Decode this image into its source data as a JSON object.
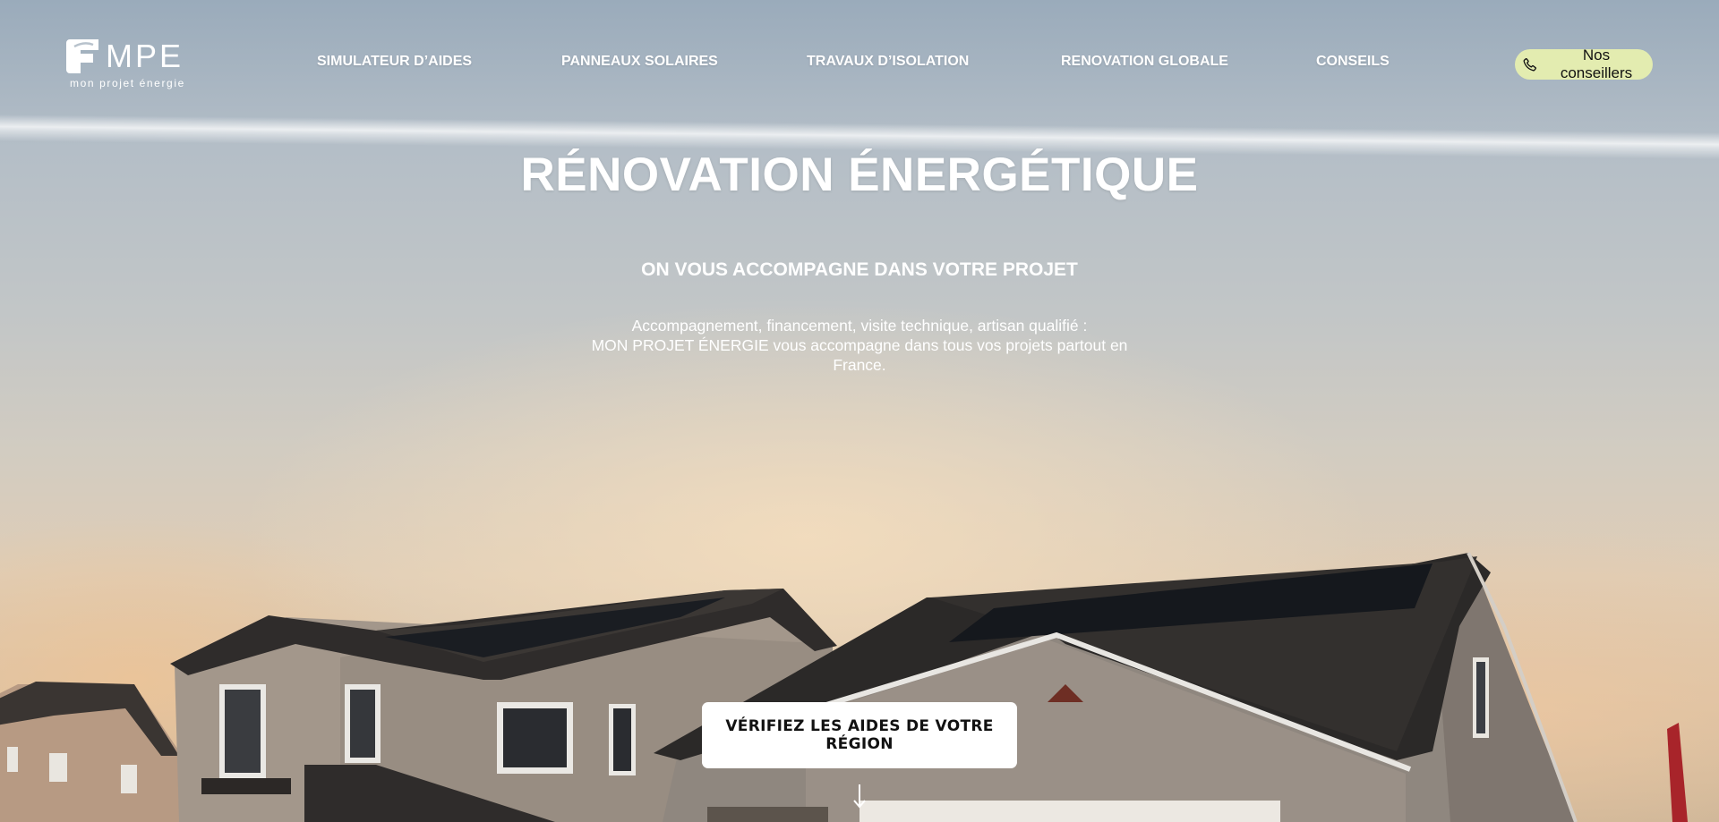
{
  "header": {
    "logo": {
      "text": "MPE",
      "tagline": "mon projet énergie"
    },
    "nav": [
      {
        "label": "SIMULATEUR D’AIDES"
      },
      {
        "label": "PANNEAUX SOLAIRES"
      },
      {
        "label": "TRAVAUX D’ISOLATION"
      },
      {
        "label": "RENOVATION GLOBALE"
      },
      {
        "label": "CONSEILS"
      }
    ],
    "contact": {
      "label": "Nos conseillers",
      "icon": "phone-icon",
      "bg": "#e3ecb0"
    }
  },
  "hero": {
    "title": "RÉNOVATION ÉNERGÉTIQUE",
    "subtitle": "ON VOUS ACCOMPAGNE DANS VOTRE PROJET",
    "description_lines": [
      "Accompagnement, financement, visite technique, artisan qualifié :",
      "MON PROJET ÉNERGIE vous accompagne dans tous vos projets partout en",
      "France."
    ],
    "cta": "VÉRIFIEZ LES AIDES DE VOTRE RÉGION",
    "scroll_icon": "arrow-down-icon"
  }
}
